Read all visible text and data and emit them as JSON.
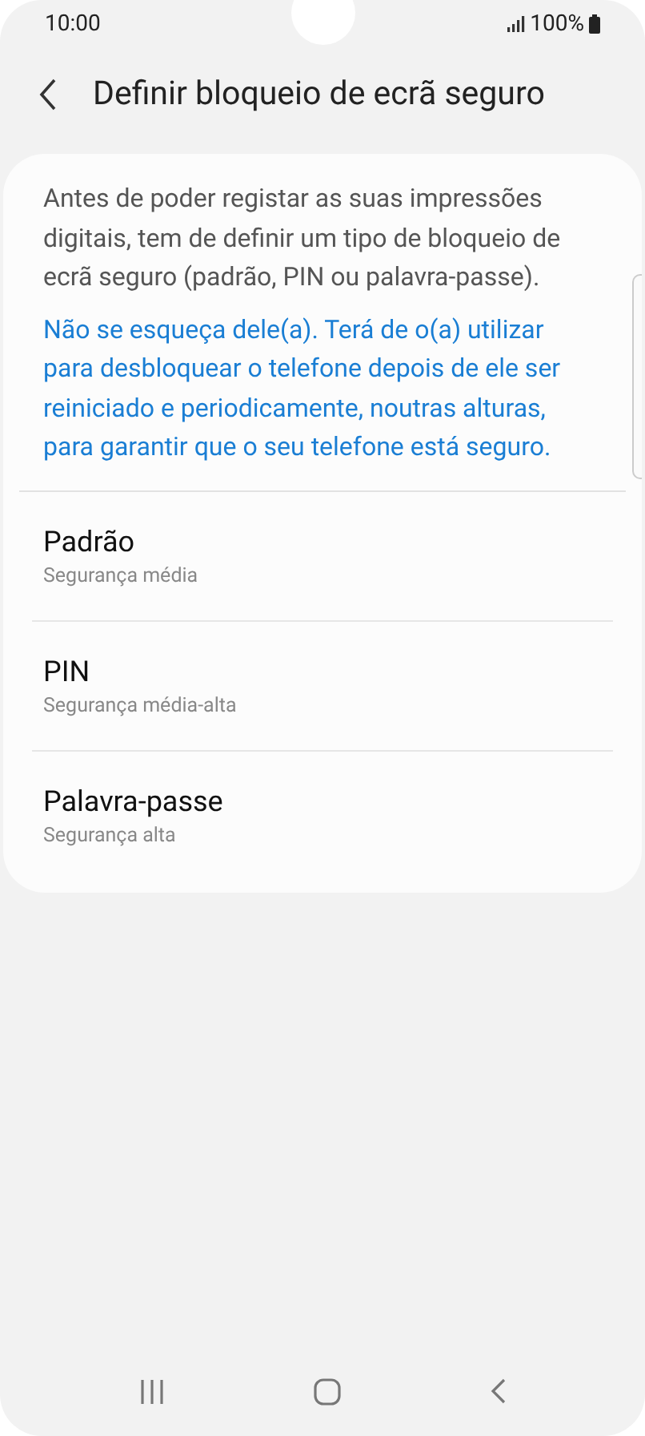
{
  "status_bar": {
    "time": "10:00",
    "battery": "100%"
  },
  "header": {
    "title": "Definir bloqueio de ecrã seguro"
  },
  "intro": "Antes de poder registar as suas impressões digitais, tem de definir um tipo de bloqueio de ecrã seguro (padrão, PIN ou palavra-passe).",
  "note": "Não se esqueça dele(a). Terá de o(a) utilizar para desbloquear o telefone depois de ele ser reiniciado e periodicamente, noutras alturas, para garantir que o seu telefone está seguro.",
  "options": [
    {
      "title": "Padrão",
      "subtitle": "Segurança média"
    },
    {
      "title": "PIN",
      "subtitle": "Segurança média-alta"
    },
    {
      "title": "Palavra-passe",
      "subtitle": "Segurança alta"
    }
  ]
}
